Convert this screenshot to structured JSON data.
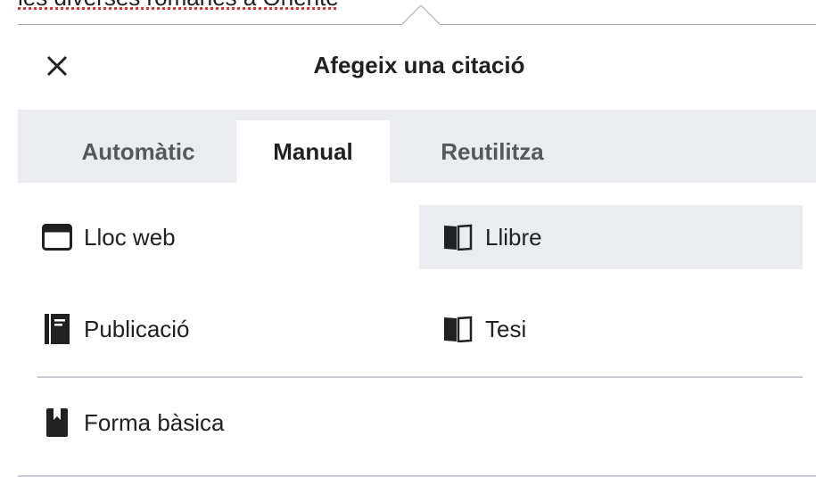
{
  "background": {
    "text": "les diverses romanes a Oriente"
  },
  "dialog": {
    "title": "Afegeix una citació",
    "close_icon": "close-icon"
  },
  "tabs": [
    {
      "label": "Automàtic",
      "active": false
    },
    {
      "label": "Manual",
      "active": true
    },
    {
      "label": "Reutilitza",
      "active": false
    }
  ],
  "options": {
    "web": {
      "label": "Lloc web",
      "icon": "browser-window-icon"
    },
    "book": {
      "label": "Llibre",
      "icon": "book-icon",
      "selected": true
    },
    "journal": {
      "label": "Publicació",
      "icon": "journal-icon"
    },
    "thesis": {
      "label": "Tesi",
      "icon": "book-icon"
    },
    "basic": {
      "label": "Forma bàsica",
      "icon": "bookmark-icon"
    }
  },
  "colors": {
    "accent_bg": "#eaecf0",
    "text": "#202122",
    "tab_inactive_text": "#54595d",
    "divider": "#c8ccd1"
  }
}
